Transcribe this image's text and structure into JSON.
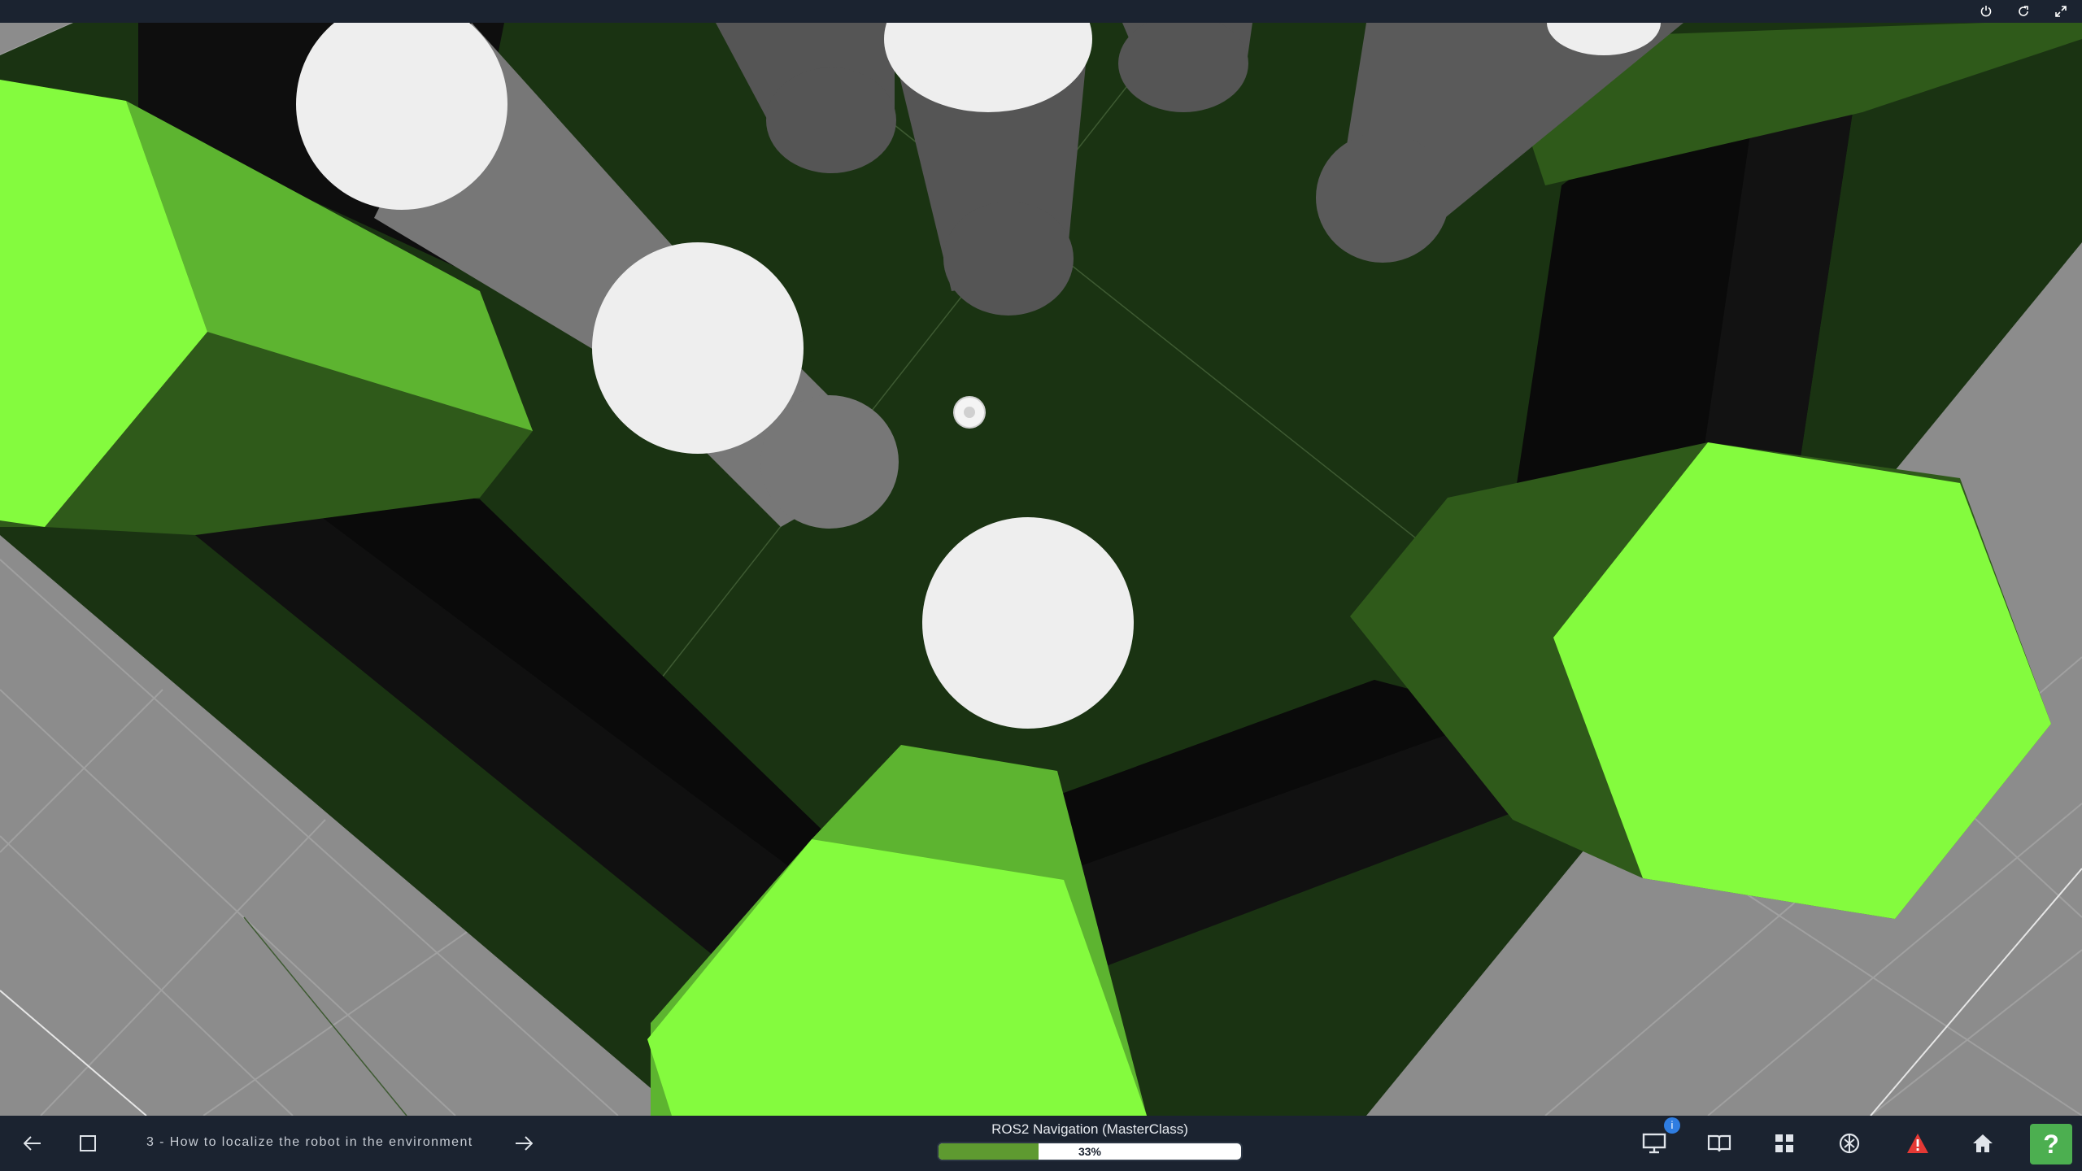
{
  "topbar": {
    "icons": [
      "power-icon",
      "refresh-icon",
      "fullscreen-icon"
    ]
  },
  "scene": {
    "description_colors": {
      "floor": "#1a3312",
      "ground": "#8c8c8c",
      "hex_top": "#84fb3e",
      "hex_side": "#5db430",
      "hex_dark_side": "#2f5a1a",
      "wall": "#0c0c0c",
      "cylinder_top": "#eeeeee",
      "cylinder_side": "#5a5a5a"
    }
  },
  "bottombar": {
    "lesson_title": "3 - How to localize the robot in the environment",
    "course_title": "ROS2 Navigation (MasterClass)",
    "progress_percent": 33,
    "progress_label": "33%",
    "notification_badge": "i",
    "help_label": "?",
    "icons": [
      "back-arrow-icon",
      "stop-square-icon",
      "forward-arrow-icon",
      "desktop-icon",
      "book-icon",
      "grid-icon",
      "ai-assistant-icon",
      "warning-icon",
      "home-icon"
    ]
  },
  "colors": {
    "bar_background": "#1b2330",
    "progress_fill": "#5e9a30",
    "help_button": "#4caf50",
    "warning": "#e53935",
    "badge": "#2f7de1"
  }
}
